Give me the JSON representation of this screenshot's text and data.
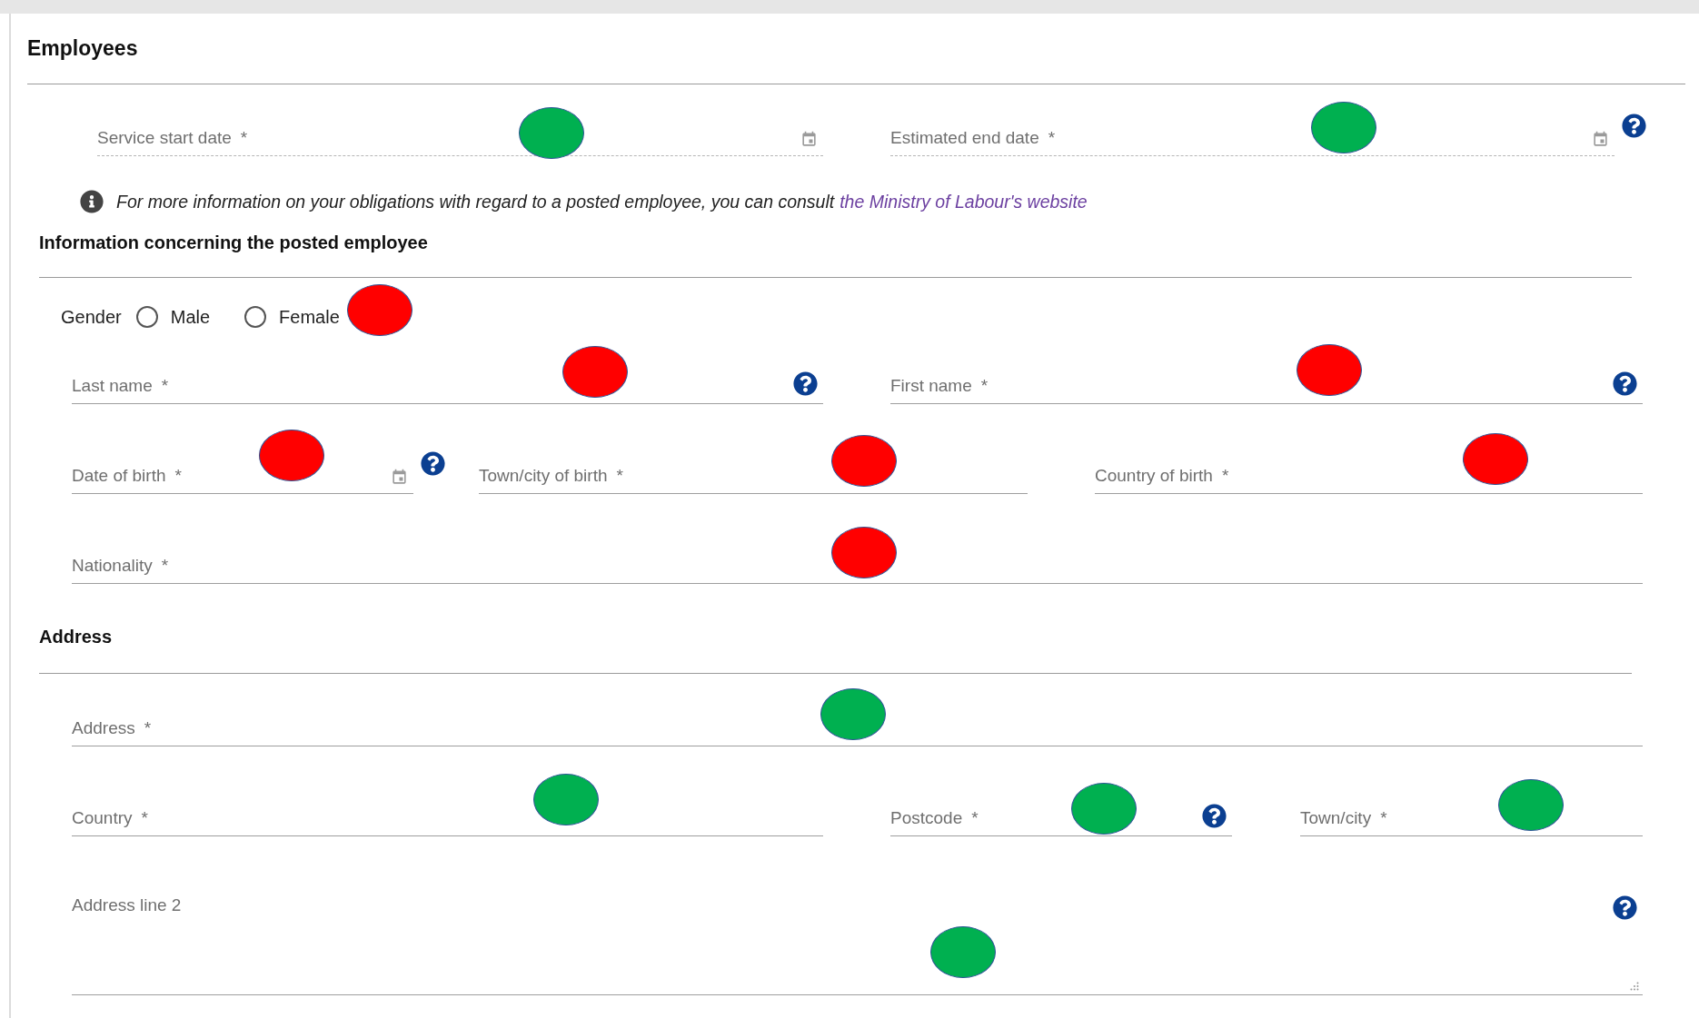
{
  "title": "Employees",
  "service_dates": [
    {
      "kind": "date",
      "label": "Service start date",
      "asterisk": "*",
      "help": false,
      "color": "#00b050"
    },
    {
      "kind": "date",
      "label": "Estimated end date",
      "asterisk": "*",
      "help": true,
      "color": "#00b050"
    }
  ],
  "note": {
    "text": "For more information on your obligations with regard to a posted employee, you can consult",
    "link": "the Ministry of Labour's website"
  },
  "posted_employee": {
    "heading": "Information concerning the posted employee",
    "gender": {
      "label": "Gender",
      "options": [
        {
          "label": "Male",
          "selected": false
        },
        {
          "label": "Female",
          "selected": false
        }
      ],
      "color": "#ff0000"
    },
    "rows": [
      [
        {
          "kind": "text",
          "label": "Last name",
          "asterisk": "*",
          "help": true,
          "color": "#ff0000"
        },
        {
          "kind": "text",
          "label": "First name",
          "asterisk": "*",
          "help": true,
          "color": "#ff0000"
        }
      ],
      [
        {
          "kind": "date",
          "label": "Date of birth",
          "asterisk": "*",
          "help": true,
          "color": "#ff0000"
        },
        {
          "kind": "text",
          "label": "Town/city of birth",
          "asterisk": "*",
          "help": false,
          "color": "#ff0000"
        },
        {
          "kind": "text",
          "label": "Country of birth",
          "asterisk": "*",
          "help": false,
          "color": "#ff0000"
        }
      ],
      [
        {
          "kind": "text",
          "label": "Nationality",
          "asterisk": "*",
          "help": false,
          "color": "#ff0000"
        }
      ]
    ]
  },
  "address": {
    "heading": "Address",
    "rows": [
      [
        {
          "kind": "text",
          "label": "Address",
          "asterisk": "*",
          "help": false,
          "color": "#00b050"
        }
      ],
      [
        {
          "kind": "text",
          "label": "Country",
          "asterisk": "*",
          "help": false,
          "color": "#00b050"
        },
        {
          "kind": "text",
          "label": "Postcode",
          "asterisk": "*",
          "help": true,
          "color": "#00b050"
        },
        {
          "kind": "text",
          "label": "Town/city",
          "asterisk": "*",
          "help": false,
          "color": "#00b050"
        }
      ],
      [
        {
          "kind": "textarea",
          "label": "Address line 2",
          "help": true,
          "color": "#00b050"
        }
      ]
    ]
  }
}
